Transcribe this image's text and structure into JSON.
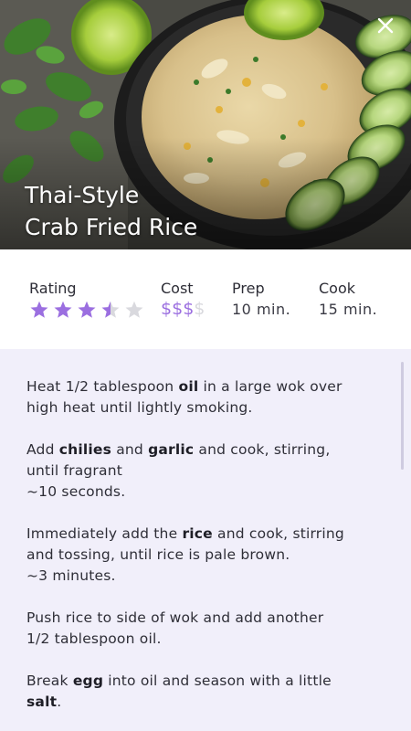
{
  "recipe": {
    "title_line1": "Thai-Style",
    "title_line2": "Crab Fried Rice"
  },
  "close_icon": "close-icon",
  "stats": {
    "rating": {
      "label": "Rating",
      "value": 3.5,
      "max": 5
    },
    "cost": {
      "label": "Cost",
      "symbols": [
        "$",
        "$",
        "$",
        "$"
      ],
      "active_count": 3
    },
    "prep": {
      "label": "Prep",
      "value": "10 min."
    },
    "cook": {
      "label": "Cook",
      "value": "15 min."
    }
  },
  "colors": {
    "accent": "#9b6fe0",
    "inactive": "#d9d9de",
    "panel_bg": "#f1effa"
  },
  "steps": [
    [
      [
        "Heat 1/2 tablespoon ",
        {
          "b": "oil"
        },
        " in a large wok over"
      ],
      [
        "high heat until lightly smoking."
      ]
    ],
    [
      [
        "Add ",
        {
          "b": "chilies"
        },
        " and ",
        {
          "b": "garlic"
        },
        " and cook, stirring,"
      ],
      [
        "until fragrant"
      ],
      [
        "~10 seconds."
      ]
    ],
    [
      [
        "Immediately add the ",
        {
          "b": "rice"
        },
        " and cook, stirring"
      ],
      [
        "and tossing, until rice is pale brown."
      ],
      [
        "~3 minutes."
      ]
    ],
    [
      [
        "Push rice to side of wok and add another"
      ],
      [
        "1/2 tablespoon oil."
      ]
    ],
    [
      [
        "Break ",
        {
          "b": "egg"
        },
        " into oil and season with a little"
      ],
      [
        {
          "b": "salt"
        },
        "."
      ]
    ]
  ]
}
